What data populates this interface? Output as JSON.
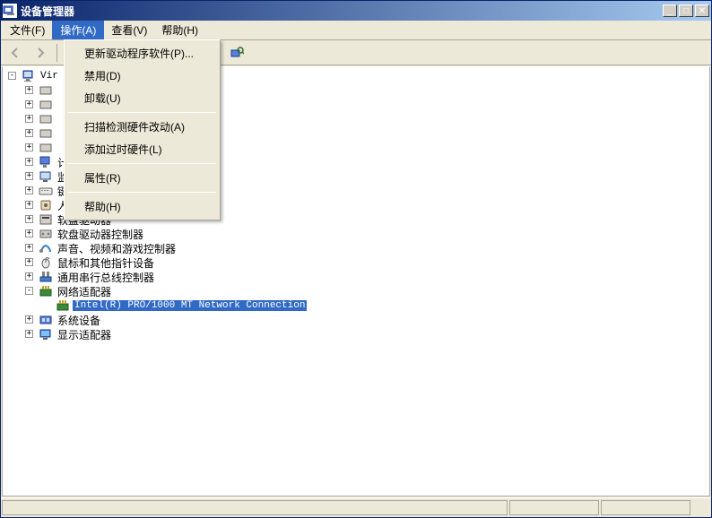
{
  "window": {
    "title": "设备管理器"
  },
  "menubar": {
    "file": "文件(F)",
    "action": "操作(A)",
    "view": "查看(V)",
    "help": "帮助(H)"
  },
  "dropdown": {
    "update_driver": "更新驱动程序软件(P)...",
    "disable": "禁用(D)",
    "uninstall": "卸载(U)",
    "scan": "扫描检测硬件改动(A)",
    "add_legacy": "添加过时硬件(L)",
    "properties": "属性(R)",
    "help": "帮助(H)"
  },
  "tree": {
    "root": "Vir",
    "nodes": [
      {
        "label": "计算机"
      },
      {
        "label": "监视器"
      },
      {
        "label": "键盘"
      },
      {
        "label": "人体学输入设备"
      },
      {
        "label": "软盘驱动器"
      },
      {
        "label": "软盘驱动器控制器"
      },
      {
        "label": "声音、视频和游戏控制器"
      },
      {
        "label": "鼠标和其他指针设备"
      },
      {
        "label": "通用串行总线控制器"
      },
      {
        "label": "网络适配器"
      },
      {
        "label": "系统设备"
      },
      {
        "label": "显示适配器"
      }
    ],
    "selected_adapter": "Intel(R) PRO/1000 MT Network Connection"
  }
}
